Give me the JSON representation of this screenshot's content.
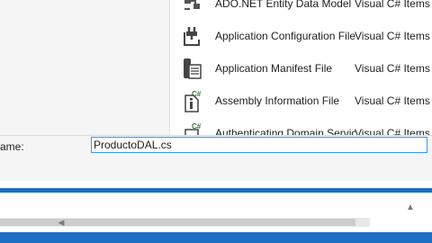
{
  "templates": {
    "items": [
      {
        "name": "ADO.NET Entity Data Model",
        "language": "Visual C# Items",
        "icon": "entity-model-icon"
      },
      {
        "name": "Application Configuration File",
        "language": "Visual C# Items",
        "icon": "config-file-icon"
      },
      {
        "name": "Application Manifest File",
        "language": "Visual C# Items",
        "icon": "manifest-file-icon"
      },
      {
        "name": "Assembly Information File",
        "language": "Visual C# Items",
        "icon": "assembly-info-icon"
      },
      {
        "name": "Authenticating Domain Service",
        "language": "Visual C# Items",
        "icon": "domain-service-icon"
      }
    ]
  },
  "name_field": {
    "label": "ame:",
    "value": "ProductoDAL.cs"
  },
  "colors": {
    "accent": "#1c6fc4",
    "focus_border": "#3399ff",
    "csharp_badge": "#2e7d32"
  }
}
